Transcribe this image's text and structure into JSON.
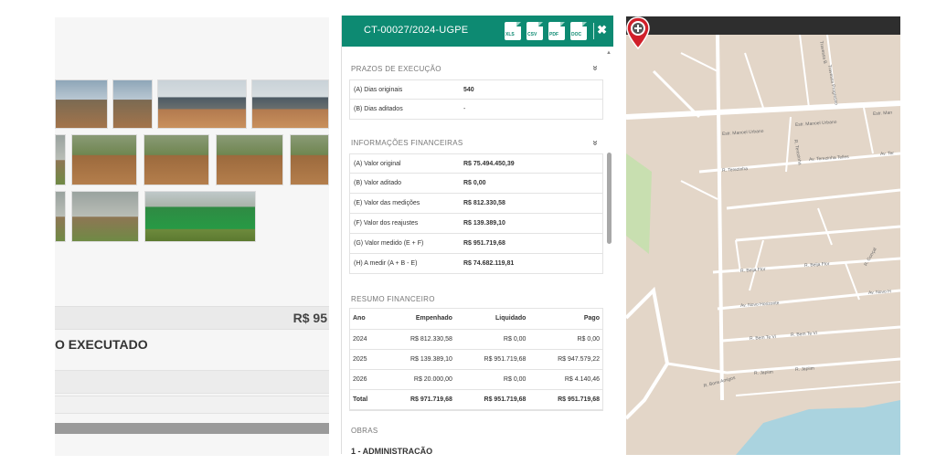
{
  "left_panel": {
    "value_text": "R$ 95",
    "heading_text": "O EXECUTADO"
  },
  "detail_panel": {
    "title": "CT-00027/2024-UGPE",
    "header_icons": [
      "xls-file-icon",
      "csv-file-icon",
      "pdf-file-icon",
      "doc-file-icon"
    ],
    "header_icon_labels": [
      "XLS",
      "CSV",
      "PDF",
      "DOC"
    ],
    "close_symbol": "✖",
    "prazos": {
      "title": "PRAZOS DE EXECUÇÃO",
      "rows": [
        {
          "label": "(A) Dias originais",
          "value": "540"
        },
        {
          "label": "(B) Dias aditados",
          "value": "-"
        }
      ]
    },
    "financeiras": {
      "title": "INFORMAÇÕES FINANCEIRAS",
      "rows": [
        {
          "label": "(A) Valor original",
          "value": "R$ 75.494.450,39"
        },
        {
          "label": "(B) Valor aditado",
          "value": "R$ 0,00"
        },
        {
          "label": "(E) Valor das medições",
          "value": "R$ 812.330,58"
        },
        {
          "label": "(F) Valor dos reajustes",
          "value": "R$ 139.389,10"
        },
        {
          "label": "(G) Valor medido (E + F)",
          "value": "R$ 951.719,68"
        },
        {
          "label": "(H) A medir (A + B - E)",
          "value": "R$ 74.682.119,81"
        }
      ]
    },
    "resumo": {
      "title": "RESUMO FINANCEIRO",
      "columns": [
        "Ano",
        "Empenhado",
        "Liquidado",
        "Pago"
      ],
      "rows": [
        [
          "2024",
          "R$ 812.330,58",
          "R$ 0,00",
          "R$ 0,00"
        ],
        [
          "2025",
          "R$ 139.389,10",
          "R$ 951.719,68",
          "R$ 947.579,22"
        ],
        [
          "2026",
          "R$ 20.000,00",
          "R$ 0,00",
          "R$ 4.140,46"
        ],
        [
          "Total",
          "R$ 971.719,68",
          "R$ 951.719,68",
          "R$ 951.719,68"
        ]
      ]
    },
    "obras": {
      "title": "OBRAS",
      "first_item": "1 - ADMINISTRAÇÃO"
    },
    "chevron": "»"
  },
  "map": {
    "streets": [
      "Estr. Manoel Urbano",
      "Estr. Manoel Urbano",
      "Estr. Man",
      "R. Terezinha",
      "Av. Terezinha Telles",
      "Av. Ter",
      "R. Beija Flor",
      "R. Beija Flor",
      "Av. Novo Horizonte",
      "Av. Novo H",
      "R. Bem Te Vi",
      "R. Bem Te Vi",
      "R. Japiim",
      "R. Japiim",
      "R. Bons Amigos",
      "Travessa B",
      "Travessa Progresso",
      "R. Terezinha",
      "R. Gonçal"
    ],
    "colors": {
      "land": "#e3d6c8",
      "road": "#ffffff",
      "water": "#aad3df",
      "park": "#c8dfb0",
      "pin": "#d0202a"
    }
  }
}
